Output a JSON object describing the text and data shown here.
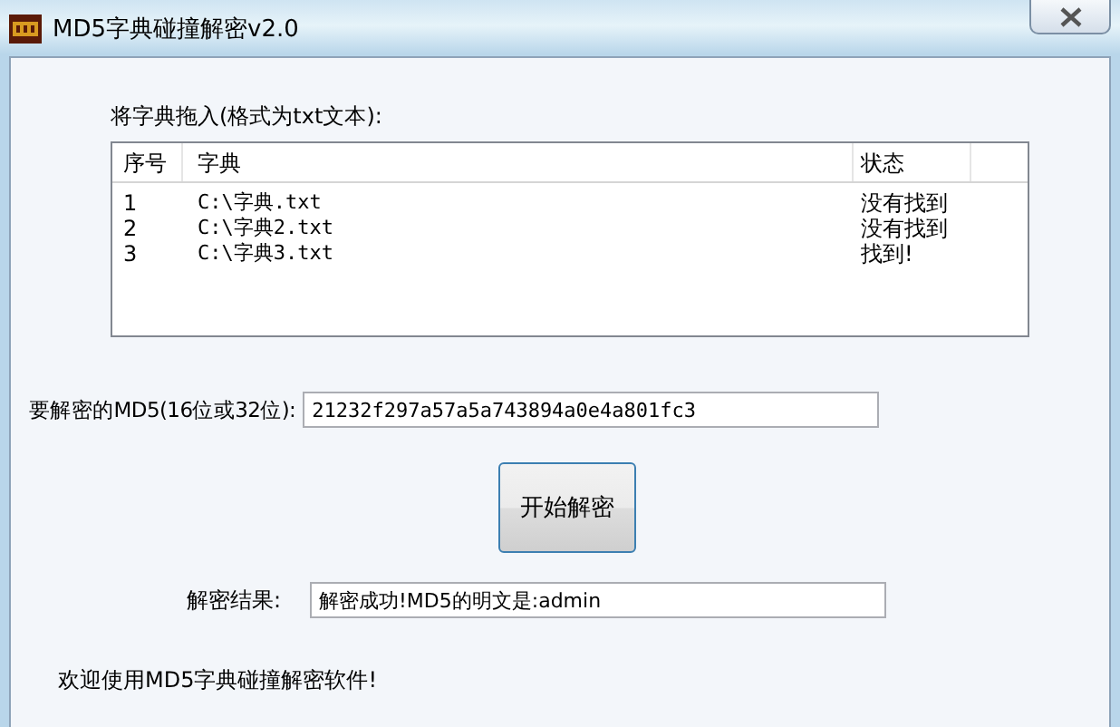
{
  "window": {
    "title": "MD5字典碰撞解密v2.0"
  },
  "drop_label": "将字典拖入(格式为txt文本):",
  "table": {
    "columns": [
      "序号",
      "字典",
      "状态"
    ],
    "rows": [
      {
        "index": "1",
        "dictionary": "C:\\字典.txt",
        "status": "没有找到"
      },
      {
        "index": "2",
        "dictionary": "C:\\字典2.txt",
        "status": "没有找到"
      },
      {
        "index": "3",
        "dictionary": "C:\\字典3.txt",
        "status": "找到!"
      }
    ]
  },
  "md5_field": {
    "label": "要解密的MD5(16位或32位):",
    "value": "21232f297a57a5a743894a0e4a801fc3"
  },
  "decrypt_button": "开始解密",
  "result_field": {
    "label": "解密结果:",
    "value": "解密成功!MD5的明文是:admin"
  },
  "status_text": "欢迎使用MD5字典碰撞解密软件!"
}
